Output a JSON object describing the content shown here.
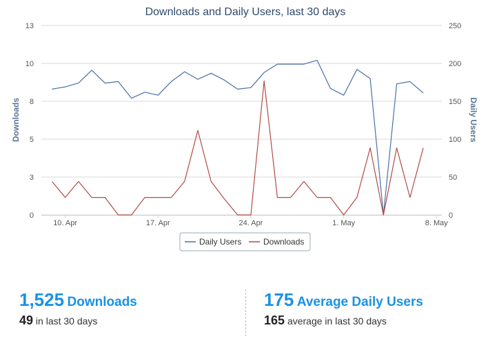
{
  "chart_data": {
    "type": "line",
    "title": "Downloads and Daily Users, last 30 days",
    "left_axis": {
      "label": "Downloads",
      "ticks": [
        0,
        3,
        5,
        8,
        10,
        13
      ],
      "range": [
        0,
        13
      ]
    },
    "right_axis": {
      "label": "Daily Users",
      "ticks": [
        0,
        50,
        100,
        150,
        200,
        250
      ],
      "range": [
        0,
        250
      ]
    },
    "x_ticks": [
      "10. Apr",
      "17. Apr",
      "24. Apr",
      "1. May",
      "8. May"
    ],
    "x_tick_positions": [
      1.0,
      8.0,
      15.0,
      22.0,
      29.0
    ],
    "x_range": [
      -0.8,
      29.4
    ],
    "series": [
      {
        "name": "Daily Users",
        "axis": "right",
        "color": "#4a6fa5",
        "values": [
          166,
          169,
          174,
          191,
          174,
          176,
          154,
          162,
          158,
          176,
          189,
          179,
          187,
          178,
          166,
          168,
          188,
          199,
          199,
          199,
          204,
          167,
          158,
          192,
          180,
          0,
          173,
          176,
          161
        ]
      },
      {
        "name": "Downloads",
        "axis": "left",
        "color": "#b24a44",
        "values": [
          2.3,
          1.2,
          2.3,
          1.2,
          1.2,
          0,
          0,
          1.2,
          1.2,
          1.2,
          2.3,
          5.8,
          2.3,
          1.1,
          0,
          0,
          9.2,
          1.2,
          1.2,
          2.3,
          1.2,
          1.2,
          0,
          1.2,
          4.6,
          0,
          4.6,
          1.2,
          4.6
        ]
      }
    ],
    "grid": true,
    "legend": "bottom-center"
  },
  "stats": {
    "downloads_total": "1,525",
    "downloads_label": "Downloads",
    "downloads_recent": "49",
    "downloads_recent_label": "in last 30 days",
    "users_total": "175",
    "users_label": "Average Daily Users",
    "users_recent": "165",
    "users_recent_label": "average in last 30 days"
  }
}
